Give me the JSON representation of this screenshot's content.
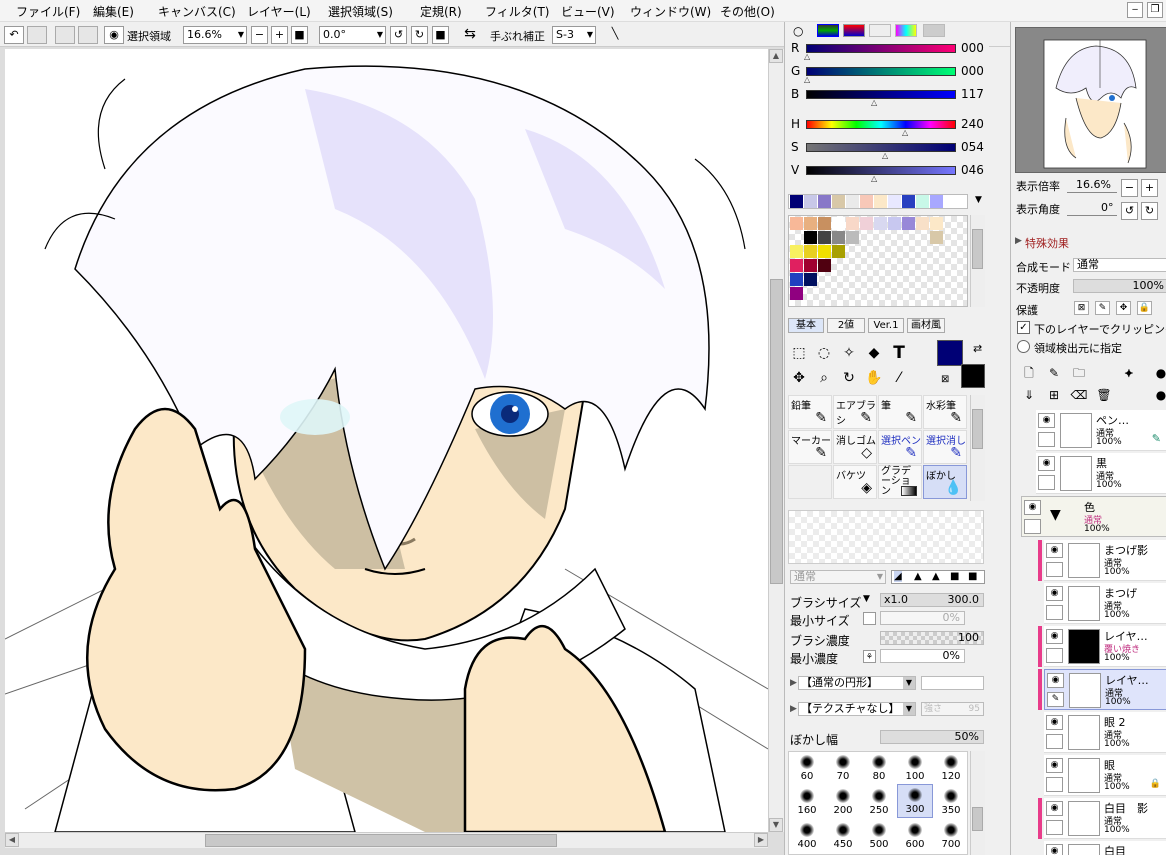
{
  "menu": [
    "ファイル(F)",
    "編集(E)",
    "キャンバス(C)",
    "レイヤー(L)",
    "選択領域(S)",
    "定規(R)",
    "フィルタ(T)",
    "ビュー(V)",
    "ウィンドウ(W)",
    "その他(O)"
  ],
  "toolbar": {
    "selection_label": "選択領域",
    "zoom": "16.6%",
    "rotation": "0.0°",
    "stabilizer_label": "手ぶれ補正",
    "stabilizer": "S-3"
  },
  "color": {
    "r": {
      "label": "R",
      "value": "000"
    },
    "g": {
      "label": "G",
      "value": "000"
    },
    "b": {
      "label": "B",
      "value": "117"
    },
    "h": {
      "label": "H",
      "value": "240"
    },
    "s": {
      "label": "S",
      "value": "054"
    },
    "v": {
      "label": "V",
      "value": "046"
    },
    "fg": "#000075",
    "bg": "#000000"
  },
  "tool_tabs": [
    "基本",
    "2値",
    "Ver.1",
    "画材風"
  ],
  "brushes": [
    {
      "label": "鉛筆"
    },
    {
      "label": "エアブラシ"
    },
    {
      "label": "筆"
    },
    {
      "label": "水彩筆"
    },
    {
      "label": "マーカー"
    },
    {
      "label": "消しゴム"
    },
    {
      "label": "選択ペン"
    },
    {
      "label": "選択消し"
    },
    {
      "label": ""
    },
    {
      "label": "バケツ"
    },
    {
      "label": "グラデーション"
    },
    {
      "label": "ぼかし"
    }
  ],
  "brush_settings": {
    "mode": "通常",
    "size_label": "ブラシサイズ",
    "size_mult": "x1.0",
    "size": "300.0",
    "min_size_label": "最小サイズ",
    "min_size": "0%",
    "density_label": "ブラシ濃度",
    "density": "100",
    "min_density_label": "最小濃度",
    "min_density": "0%",
    "shape": "【通常の円形】",
    "texture": "【テクスチャなし】",
    "texture_strength_label": "強さ",
    "texture_strength": "95",
    "blur_label": "ぼかし幅",
    "blur": "50%"
  },
  "brush_sizes": [
    "60",
    "70",
    "80",
    "100",
    "120",
    "160",
    "200",
    "250",
    "300",
    "350",
    "400",
    "450",
    "500",
    "600",
    "700"
  ],
  "navigator": {
    "zoom_label": "表示倍率",
    "zoom": "16.6%",
    "angle_label": "表示角度",
    "angle": "0°"
  },
  "layer_props": {
    "effects": "特殊効果",
    "blend_label": "合成モード",
    "blend": "通常",
    "opacity_label": "不透明度",
    "opacity": "100%",
    "protect_label": "保護",
    "clip": "下のレイヤーでクリッピング",
    "source": "領域検出元に指定"
  },
  "layers": [
    {
      "name": "ペン…",
      "mode": "通常",
      "opacity": "100%"
    },
    {
      "name": "黒",
      "mode": "通常",
      "opacity": "100%"
    },
    {
      "name": "色",
      "mode": "通常",
      "opacity": "100%"
    },
    {
      "name": "まつげ影",
      "mode": "通常",
      "opacity": "100%"
    },
    {
      "name": "まつげ",
      "mode": "通常",
      "opacity": "100%"
    },
    {
      "name": "レイヤ…",
      "mode": "覆い焼き",
      "opacity": "100%"
    },
    {
      "name": "レイヤ…",
      "mode": "通常",
      "opacity": "100%"
    },
    {
      "name": "眼 2",
      "mode": "通常",
      "opacity": "100%"
    },
    {
      "name": "眼",
      "mode": "通常",
      "opacity": "100%"
    },
    {
      "name": "白目　影",
      "mode": "通常",
      "opacity": "100%"
    },
    {
      "name": "白目",
      "mode": "",
      "opacity": ""
    }
  ]
}
